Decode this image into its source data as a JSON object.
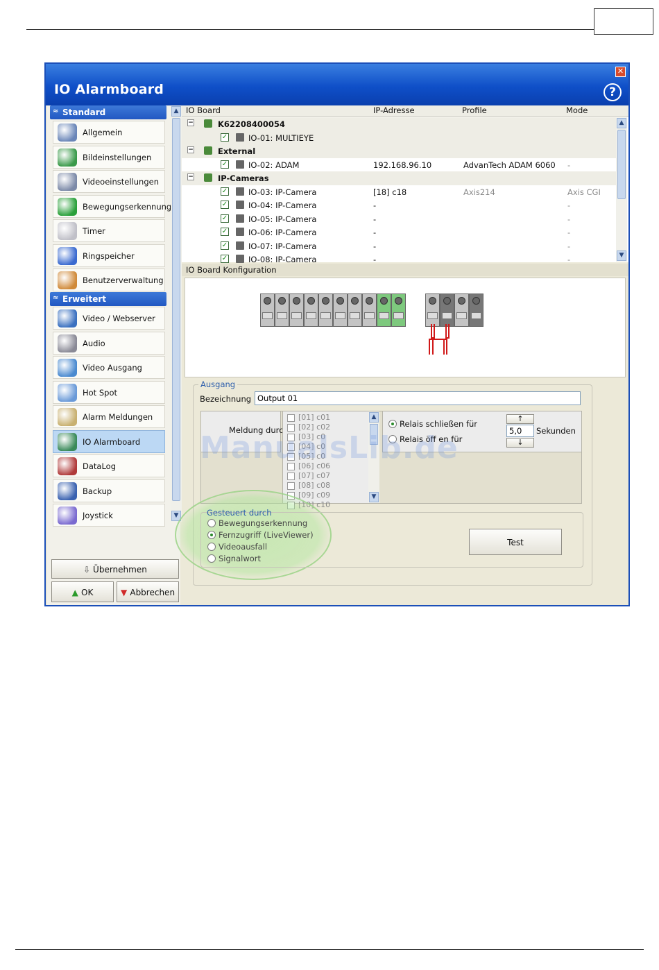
{
  "page": {
    "box_text": ""
  },
  "window": {
    "title": "IO Alarmboard",
    "close_symbol": "✕",
    "help_symbol": "?"
  },
  "sidebar": {
    "sections": [
      {
        "label": "Standard",
        "items": [
          {
            "label": "Allgemein",
            "icon": "gear-icon",
            "color": "#6a86b8"
          },
          {
            "label": "Bildeinstellungen",
            "icon": "landscape-icon",
            "color": "#3a9a4a"
          },
          {
            "label": "Videoeinstellungen",
            "icon": "video-camera-icon",
            "color": "#7c8aa8"
          },
          {
            "label": "Bewegungserkennung",
            "icon": "running-man-icon",
            "color": "#2aa03a"
          },
          {
            "label": "Timer",
            "icon": "calendar-clock-icon",
            "color": "#c0c0c8"
          },
          {
            "label": "Ringspeicher",
            "icon": "pie-chart-icon",
            "color": "#3a6ad0"
          },
          {
            "label": "Benutzerverwaltung",
            "icon": "users-icon",
            "color": "#d08a3a"
          }
        ]
      },
      {
        "label": "Erweitert",
        "items": [
          {
            "label": "Video / Webserver",
            "icon": "globe-icon",
            "color": "#3a70c0"
          },
          {
            "label": "Audio",
            "icon": "speaker-icon",
            "color": "#8a8a96"
          },
          {
            "label": "Video Ausgang",
            "icon": "monitor-icon",
            "color": "#4a8ad0"
          },
          {
            "label": "Hot Spot",
            "icon": "network-icon",
            "color": "#6a9ad8"
          },
          {
            "label": "Alarm Meldungen",
            "icon": "alarm-mail-icon",
            "color": "#c8b070"
          },
          {
            "label": "IO Alarmboard",
            "icon": "circuit-board-icon",
            "color": "#3a8a5a"
          },
          {
            "label": "DataLog",
            "icon": "database-icon",
            "color": "#b03a3a"
          },
          {
            "label": "Backup",
            "icon": "backup-drive-icon",
            "color": "#3a62b0"
          },
          {
            "label": "Joystick",
            "icon": "joystick-icon",
            "color": "#7a6ad0"
          }
        ]
      }
    ],
    "apply_label": "Übernehmen",
    "ok_label": "OK",
    "cancel_label": "Abbrechen"
  },
  "tree": {
    "columns": [
      "IO Board",
      "IP-Adresse",
      "Profile",
      "Mode"
    ],
    "rows": [
      {
        "level": "group",
        "name": "K62208400054",
        "ip": "",
        "profile": "",
        "mode": ""
      },
      {
        "level": "item",
        "name": "IO-01: MULTIEYE",
        "ip": "",
        "profile": "",
        "mode": ""
      },
      {
        "level": "group",
        "name": "External",
        "ip": "",
        "profile": "",
        "mode": ""
      },
      {
        "level": "item",
        "name": "IO-02: ADAM",
        "ip": "192.168.96.10",
        "profile": "AdvanTech ADAM 6060",
        "mode": "-"
      },
      {
        "level": "group",
        "name": "IP-Cameras",
        "ip": "",
        "profile": "",
        "mode": ""
      },
      {
        "level": "item",
        "name": "IO-03: IP-Camera",
        "ip": "[18] c18",
        "profile": "Axis214",
        "mode": "Axis CGI"
      },
      {
        "level": "item",
        "name": "IO-04: IP-Camera",
        "ip": "-",
        "profile": "",
        "mode": "-"
      },
      {
        "level": "item",
        "name": "IO-05: IP-Camera",
        "ip": "-",
        "profile": "",
        "mode": "-"
      },
      {
        "level": "item",
        "name": "IO-06: IP-Camera",
        "ip": "-",
        "profile": "",
        "mode": "-"
      },
      {
        "level": "item",
        "name": "IO-07: IP-Camera",
        "ip": "-",
        "profile": "",
        "mode": "-"
      },
      {
        "level": "item",
        "name": "IO-08: IP-Camera",
        "ip": "-",
        "profile": "",
        "mode": "-"
      }
    ]
  },
  "config": {
    "title": "IO Board Konfiguration"
  },
  "output": {
    "legend": "Ausgang",
    "name_label": "Bezeichnung",
    "name_value": "Output 01",
    "message_label": "Meldung durch",
    "camera_list": [
      "[01] c01",
      "[02] c02",
      "[03] c0",
      "[04] c0",
      "[05] c0",
      "[06] c06",
      "[07] c07",
      "[08] c08",
      "[09] c09",
      "[10] c10"
    ],
    "relay_close_label": "Relais schließen für",
    "relay_open_label": "Relais öff  en für",
    "seconds_value": "5,0",
    "seconds_label": "Sekunden",
    "up_symbol": "↑",
    "down_symbol": "↓"
  },
  "controlled": {
    "legend": "Gesteuert durch",
    "options": [
      {
        "label": "Bewegungserkennung",
        "selected": false
      },
      {
        "label": "Fernzugriff (LiveViewer)",
        "selected": true
      },
      {
        "label": "Videoausfall",
        "selected": false
      },
      {
        "label": "Signalwort",
        "selected": false
      }
    ],
    "test_label": "Test"
  },
  "watermark": "ManualsLib.de",
  "colors": {
    "title_bar": "#0f4fc8",
    "accent_green": "#7ec97e",
    "relay_red": "#d01818"
  }
}
